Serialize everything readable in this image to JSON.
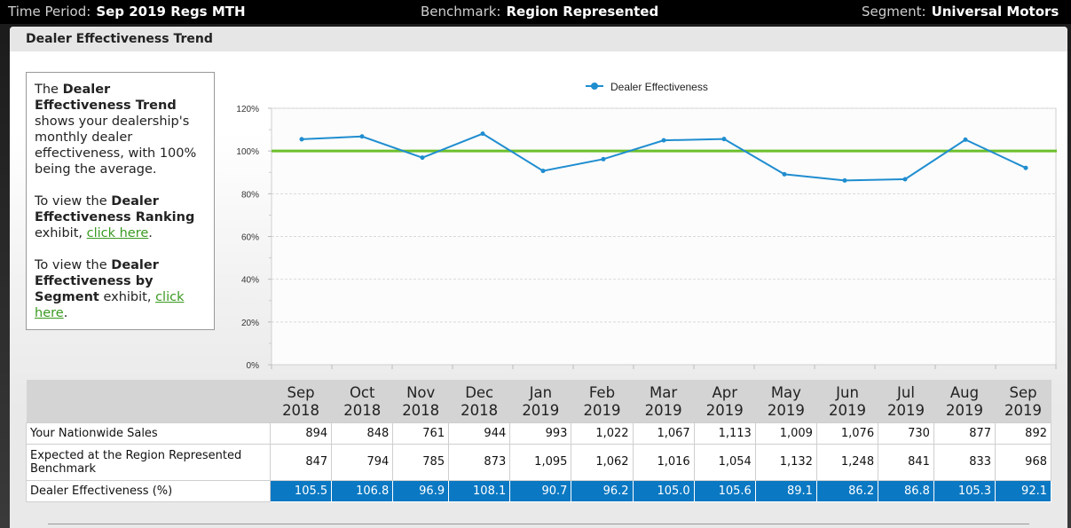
{
  "topbar": {
    "time_period_label": "Time Period:",
    "time_period_value": "Sep 2019 Regs MTH",
    "benchmark_label": "Benchmark:",
    "benchmark_value": "Region Represented",
    "segment_label": "Segment:",
    "segment_value": "Universal Motors"
  },
  "panel": {
    "title": "Dealer Effectiveness Trend"
  },
  "info": {
    "p1_pre": "The ",
    "p1_bold": "Dealer Effectiveness Trend",
    "p1_post": " shows your dealership's monthly dealer effectiveness, with 100% being the average.",
    "p2_pre": "To view the ",
    "p2_bold": "Dealer Effectiveness Ranking",
    "p2_mid": " exhibit, ",
    "p2_link": "click here",
    "p2_post": ".",
    "p3_pre": "To view the ",
    "p3_bold": "Dealer Effectiveness by Segment",
    "p3_mid": " exhibit, ",
    "p3_link": "click here",
    "p3_post": "."
  },
  "chart_data": {
    "type": "line",
    "categories": [
      "Sep 2018",
      "Oct 2018",
      "Nov 2018",
      "Dec 2018",
      "Jan 2019",
      "Feb 2019",
      "Mar 2019",
      "Apr 2019",
      "May 2019",
      "Jun 2019",
      "Jul 2019",
      "Aug 2019",
      "Sep 2019"
    ],
    "series": [
      {
        "name": "Dealer Effectiveness",
        "values": [
          105.5,
          106.8,
          96.9,
          108.1,
          90.7,
          96.2,
          105.0,
          105.6,
          89.1,
          86.2,
          86.8,
          105.3,
          92.1
        ],
        "color": "#1f8dd0"
      }
    ],
    "reference_line": {
      "value": 100,
      "color": "#6cc02c"
    },
    "yticks": [
      "0%",
      "20%",
      "40%",
      "60%",
      "80%",
      "100%",
      "120%"
    ],
    "ylim": [
      0,
      120
    ],
    "grid": true,
    "legend_position": "top-center"
  },
  "table": {
    "months": [
      {
        "m": "Sep",
        "y": "2018"
      },
      {
        "m": "Oct",
        "y": "2018"
      },
      {
        "m": "Nov",
        "y": "2018"
      },
      {
        "m": "Dec",
        "y": "2018"
      },
      {
        "m": "Jan",
        "y": "2019"
      },
      {
        "m": "Feb",
        "y": "2019"
      },
      {
        "m": "Mar",
        "y": "2019"
      },
      {
        "m": "Apr",
        "y": "2019"
      },
      {
        "m": "May",
        "y": "2019"
      },
      {
        "m": "Jun",
        "y": "2019"
      },
      {
        "m": "Jul",
        "y": "2019"
      },
      {
        "m": "Aug",
        "y": "2019"
      },
      {
        "m": "Sep",
        "y": "2019"
      }
    ],
    "rows": [
      {
        "label": "Your Nationwide Sales",
        "values": [
          "894",
          "848",
          "761",
          "944",
          "993",
          "1,022",
          "1,067",
          "1,113",
          "1,009",
          "1,076",
          "730",
          "877",
          "892"
        ]
      },
      {
        "label": "Expected at the Region Represented Benchmark",
        "values": [
          "847",
          "794",
          "785",
          "873",
          "1,095",
          "1,062",
          "1,016",
          "1,054",
          "1,132",
          "1,248",
          "841",
          "833",
          "968"
        ]
      },
      {
        "label": "Dealer Effectiveness (%)",
        "values": [
          "105.5",
          "106.8",
          "96.9",
          "108.1",
          "90.7",
          "96.2",
          "105.0",
          "105.6",
          "89.1",
          "86.2",
          "86.8",
          "105.3",
          "92.1"
        ]
      }
    ]
  }
}
